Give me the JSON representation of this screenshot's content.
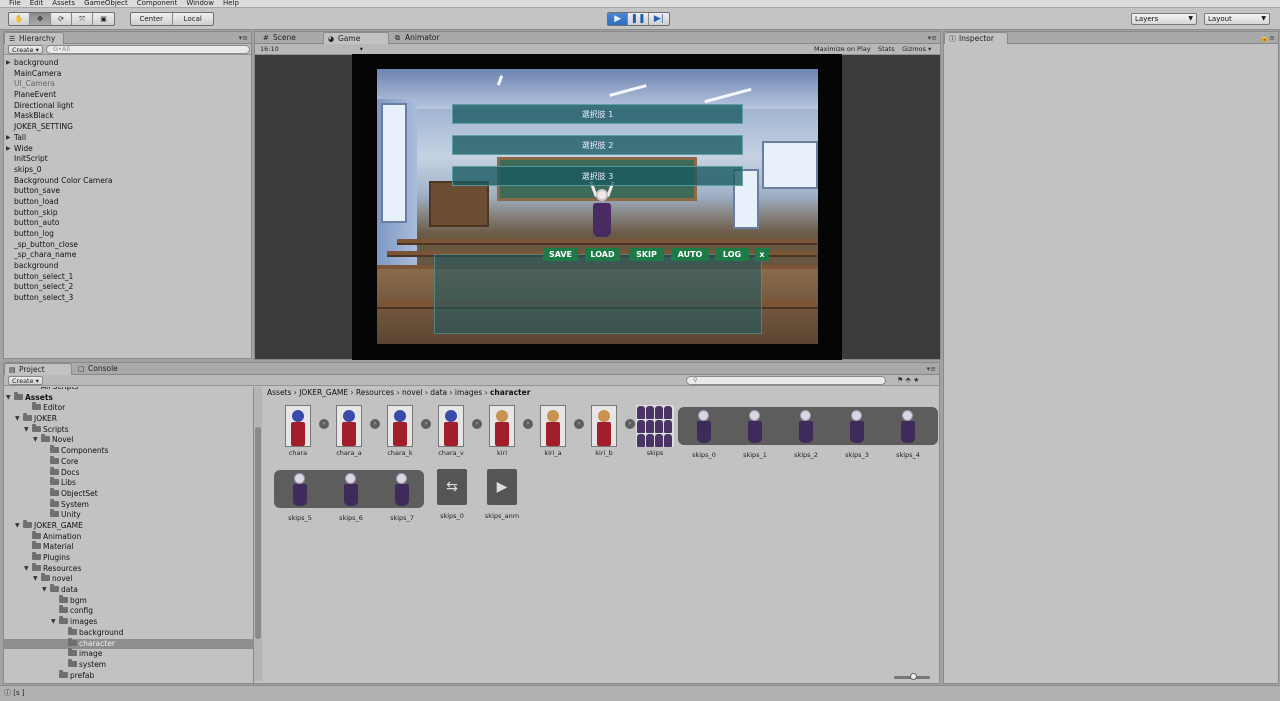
{
  "menu": [
    "File",
    "Edit",
    "Assets",
    "GameObject",
    "Component",
    "Window",
    "Help"
  ],
  "toolbar": {
    "pivot": "Center",
    "space": "Local",
    "layers": "Layers",
    "layout": "Layout"
  },
  "hierarchy": {
    "tab": "Hierarchy",
    "create": "Create",
    "search_placeholder": "G•All",
    "items": [
      {
        "label": "background",
        "expand": true
      },
      {
        "label": "MainCamera",
        "expand": false
      },
      {
        "label": "UI_Camera",
        "expand": false,
        "dim": true
      },
      {
        "label": "PlaneEvent",
        "expand": false
      },
      {
        "label": "Directional light",
        "expand": false
      },
      {
        "label": "MaskBlack",
        "expand": false
      },
      {
        "label": "JOKER_SETTING",
        "expand": false
      },
      {
        "label": "Tall",
        "expand": true
      },
      {
        "label": "Wide",
        "expand": true
      },
      {
        "label": "InitScript",
        "expand": false
      },
      {
        "label": "skips_0",
        "expand": false
      },
      {
        "label": "Background Color Camera",
        "expand": false
      },
      {
        "label": "button_save",
        "expand": false
      },
      {
        "label": "button_load",
        "expand": false
      },
      {
        "label": "button_skip",
        "expand": false
      },
      {
        "label": "button_auto",
        "expand": false
      },
      {
        "label": "button_log",
        "expand": false
      },
      {
        "label": "_sp_button_close",
        "expand": false
      },
      {
        "label": "_sp_chara_name",
        "expand": false
      },
      {
        "label": "background",
        "expand": false
      },
      {
        "label": "button_select_1",
        "expand": false
      },
      {
        "label": "button_select_2",
        "expand": false
      },
      {
        "label": "button_select_3",
        "expand": false
      }
    ]
  },
  "views": {
    "scene_tab": "Scene",
    "game_tab": "Game",
    "animator_tab": "Animator",
    "aspect": "16:10",
    "maximize": "Maximize on Play",
    "stats": "Stats",
    "gizmos": "Gizmos"
  },
  "game": {
    "choices": [
      "選択肢 1",
      "選択肢 2",
      "選択肢 3"
    ],
    "buttons": [
      "SAVE",
      "LOAD",
      "SKIP",
      "AUTO",
      "LOG",
      "x"
    ],
    "accent": "#1e7a46"
  },
  "inspector": {
    "tab": "Inspector"
  },
  "project": {
    "tab": "Project",
    "console_tab": "Console",
    "create": "Create",
    "tree": [
      {
        "label": "All Scripts",
        "indent": 3,
        "folder": false,
        "cut": true
      },
      {
        "label": "Assets",
        "indent": 0,
        "folder": true,
        "expand": true,
        "bold": true
      },
      {
        "label": "Editor",
        "indent": 2,
        "folder": true
      },
      {
        "label": "JOKER",
        "indent": 1,
        "folder": true,
        "expand": true
      },
      {
        "label": "Scripts",
        "indent": 2,
        "folder": true,
        "expand": true
      },
      {
        "label": "Novel",
        "indent": 3,
        "folder": true,
        "expand": true
      },
      {
        "label": "Components",
        "indent": 4,
        "folder": true
      },
      {
        "label": "Core",
        "indent": 4,
        "folder": true
      },
      {
        "label": "Docs",
        "indent": 4,
        "folder": true
      },
      {
        "label": "Libs",
        "indent": 4,
        "folder": true
      },
      {
        "label": "ObjectSet",
        "indent": 4,
        "folder": true
      },
      {
        "label": "System",
        "indent": 4,
        "folder": true
      },
      {
        "label": "Unity",
        "indent": 4,
        "folder": true
      },
      {
        "label": "JOKER_GAME",
        "indent": 1,
        "folder": true,
        "expand": true
      },
      {
        "label": "Animation",
        "indent": 2,
        "folder": true
      },
      {
        "label": "Material",
        "indent": 2,
        "folder": true
      },
      {
        "label": "Plugins",
        "indent": 2,
        "folder": true
      },
      {
        "label": "Resources",
        "indent": 2,
        "folder": true,
        "expand": true
      },
      {
        "label": "novel",
        "indent": 3,
        "folder": true,
        "expand": true
      },
      {
        "label": "data",
        "indent": 4,
        "folder": true,
        "expand": true
      },
      {
        "label": "bgm",
        "indent": 5,
        "folder": true
      },
      {
        "label": "config",
        "indent": 5,
        "folder": true
      },
      {
        "label": "images",
        "indent": 5,
        "folder": true,
        "expand": true
      },
      {
        "label": "background",
        "indent": 6,
        "folder": true
      },
      {
        "label": "character",
        "indent": 6,
        "folder": true,
        "selected": true
      },
      {
        "label": "image",
        "indent": 6,
        "folder": true
      },
      {
        "label": "system",
        "indent": 6,
        "folder": true
      },
      {
        "label": "prefab",
        "indent": 5,
        "folder": true,
        "cut": true
      }
    ],
    "breadcrumb": [
      "Assets",
      "JOKER_GAME",
      "Resources",
      "novel",
      "data",
      "images",
      "character"
    ],
    "assets_row1": [
      {
        "label": "chara",
        "hair": "#3a4aa8"
      },
      {
        "label": "chara_a",
        "hair": "#3a4aa8"
      },
      {
        "label": "chara_k",
        "hair": "#3a4aa8"
      },
      {
        "label": "chara_v",
        "hair": "#3a4aa8"
      },
      {
        "label": "kiri",
        "hair": "#c9924f"
      },
      {
        "label": "kiri_a",
        "hair": "#c9924f"
      },
      {
        "label": "kiri_b",
        "hair": "#c9924f"
      }
    ],
    "skips_label": "skips",
    "strip1": [
      "skips_0",
      "skips_1",
      "skips_2",
      "skips_3",
      "skips_4"
    ],
    "strip2": [
      "skips_5",
      "skips_6",
      "skips_7"
    ],
    "extra_assets": [
      "skips_0",
      "skips_anm"
    ]
  },
  "status": "[s ]"
}
